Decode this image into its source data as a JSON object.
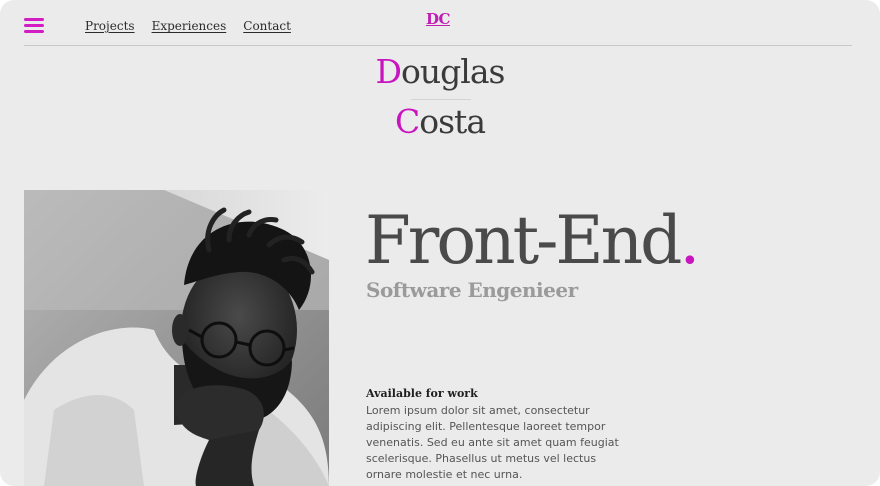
{
  "header": {
    "menu_icon": "hamburger-menu-icon",
    "nav": [
      "Projects",
      "Experiences",
      "Contact"
    ],
    "logo": "DC"
  },
  "name": {
    "first_initial": "D",
    "first_rest": "ouglas",
    "last_initial": "C",
    "last_rest": "osta"
  },
  "hero": {
    "title": "Front-End",
    "title_dot": ".",
    "subtitle": "Software Engenieer"
  },
  "availability": {
    "title": "Available for work",
    "body": "Lorem ipsum dolor sit amet, consectetur adipiscing elit. Pellentesque laoreet tempor venenatis. Sed eu ante sit amet quam feugiat scelerisque. Phasellus ut metus vel lectus ornare molestie et nec urna."
  },
  "colors": {
    "accent": "#c815c0",
    "background": "#ebebeb",
    "text": "#4a4a4a"
  }
}
